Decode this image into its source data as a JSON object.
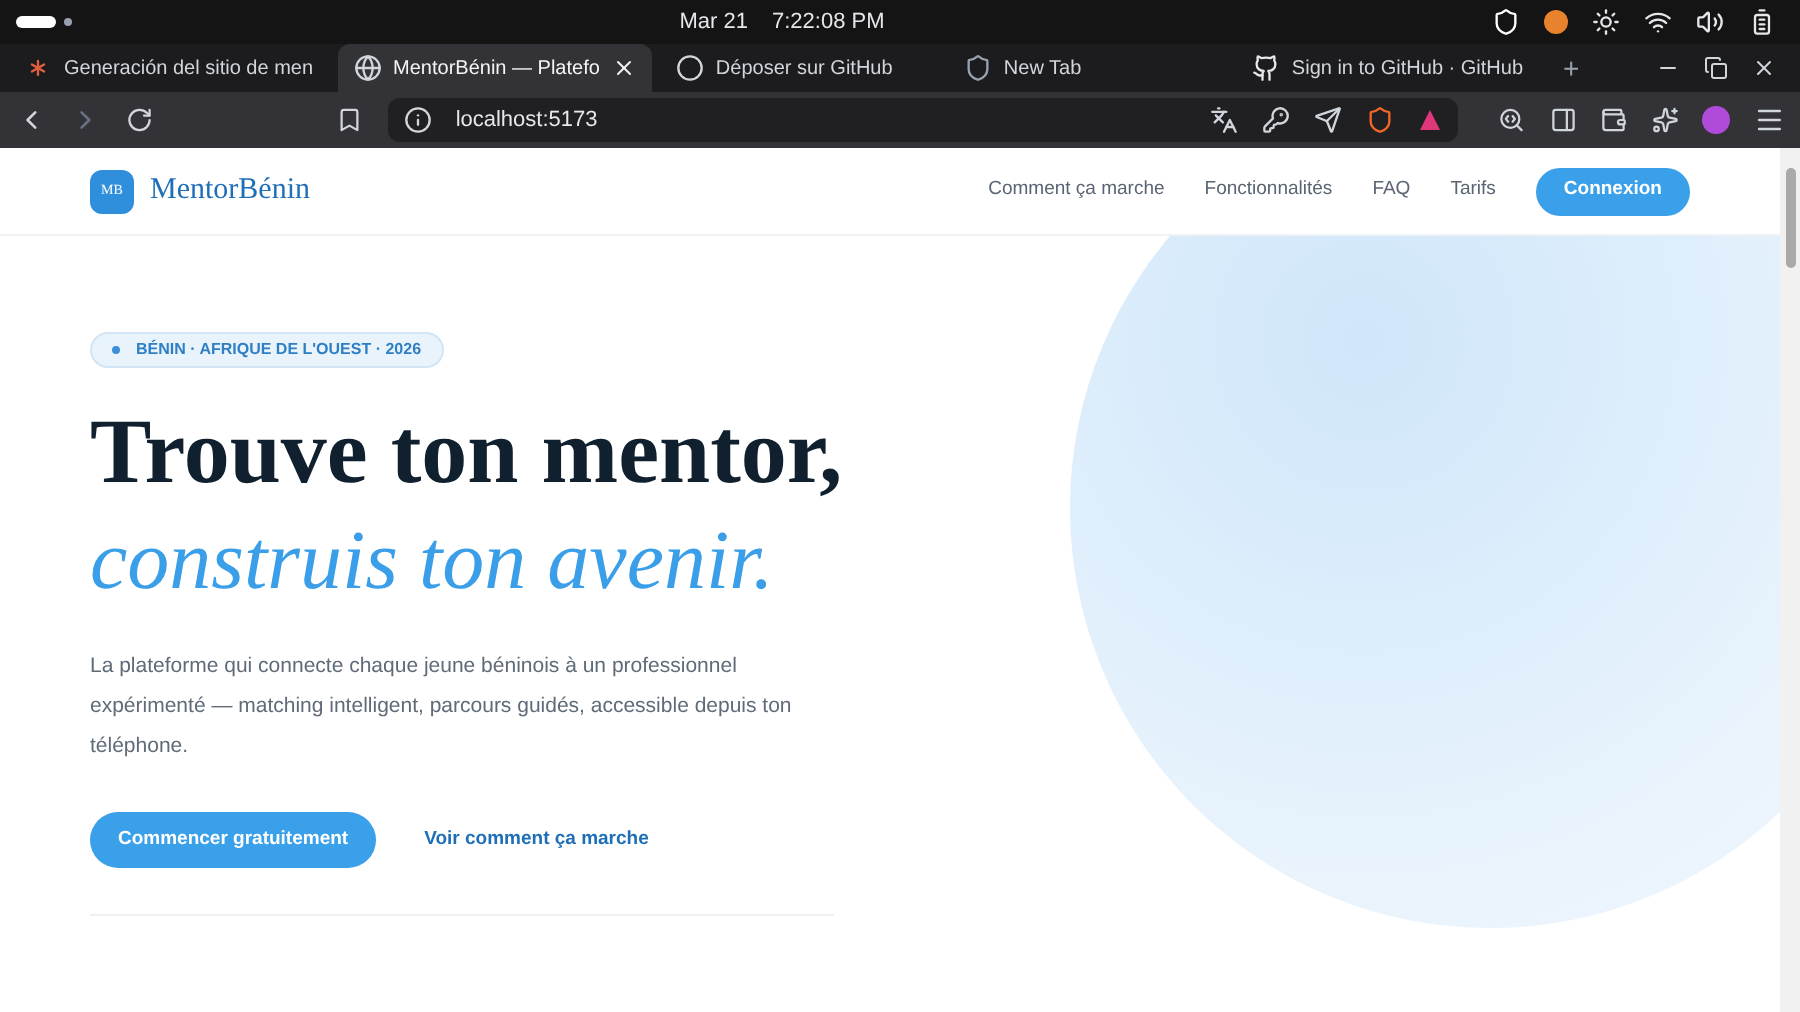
{
  "system_bar": {
    "date": "Mar 21",
    "time": "7:22:08 PM"
  },
  "tabs": [
    {
      "title": "Generación del sitio de men",
      "selected": false
    },
    {
      "title": "MentorBénin — Platefo",
      "selected": true
    },
    {
      "title": "Déposer sur GitHub",
      "selected": false
    },
    {
      "title": "New Tab",
      "selected": false
    },
    {
      "title": "Sign in to GitHub · GitHub",
      "selected": false
    }
  ],
  "new_tab": "+",
  "address_bar": {
    "url": "localhost:5173"
  },
  "site": {
    "logo_mark": "MB",
    "logo_text": "MentorBénin",
    "nav": [
      "Comment ça marche",
      "Fonctionnalités",
      "FAQ",
      "Tarifs"
    ],
    "login": "Connexion"
  },
  "hero": {
    "badge": "BÉNIN · AFRIQUE DE L'OUEST · 2026",
    "title_line_1": "Trouve ton mentor,",
    "title_line_2": "construis ton avenir.",
    "description": "La plateforme qui connecte chaque jeune béninois à un professionnel expérimenté — matching intelligent, parcours guidés, accessible depuis ton téléphone.",
    "primary_button": "Commencer gratuitement",
    "secondary_link": "Voir comment ça marche"
  }
}
